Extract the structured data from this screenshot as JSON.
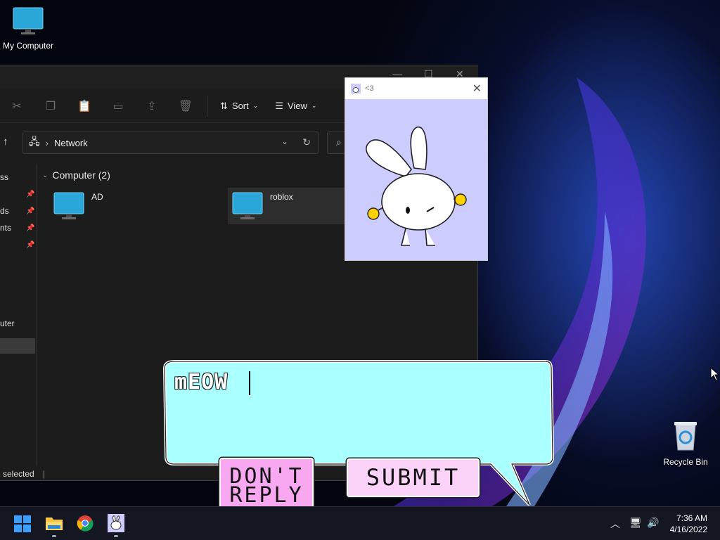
{
  "desktop": {
    "my_computer_label": "My Computer",
    "recycle_bin_label": "Recycle Bin"
  },
  "explorer": {
    "toolbar": {
      "sort_label": "Sort",
      "view_label": "View"
    },
    "address": {
      "path": "Network"
    },
    "nav_items": [
      "ss",
      "ds",
      "nts",
      "uter"
    ],
    "group_header": "Computer (2)",
    "items": [
      {
        "name": "AD"
      },
      {
        "name": "roblox"
      }
    ],
    "status": "selected"
  },
  "bunny_window": {
    "title": "<3"
  },
  "bubble": {
    "text": "mEOW",
    "dont_reply_label": "DON'T\nREPLY",
    "submit_label": "SUBMIT"
  },
  "taskbar": {
    "time": "7:36 AM",
    "date": "4/16/2022"
  },
  "colors": {
    "bubble_fill": "#aaffff",
    "dont_reply_fill": "#f7a8f0",
    "submit_fill": "#fbd3f8",
    "bunny_bg": "#ccccff"
  }
}
